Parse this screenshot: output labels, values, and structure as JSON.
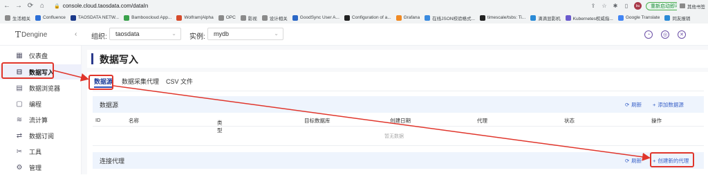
{
  "browser": {
    "url": "console.cloud.taosdata.com/dataIn",
    "relaunch_label": "重新启动即可更新",
    "profile_initial": "bu",
    "bookmarks": [
      {
        "label": "生活相关",
        "color": "#8a8a8a"
      },
      {
        "label": "Confluence",
        "color": "#2c6fd6"
      },
      {
        "label": "TAOSDATA NETW...",
        "color": "#1b3a8a"
      },
      {
        "label": "Bamboocloud App...",
        "color": "#3aa14b"
      },
      {
        "label": "Wolfram|Alpha",
        "color": "#d64b2c"
      },
      {
        "label": "OPC",
        "color": "#8a8a8a"
      },
      {
        "label": "影视",
        "color": "#8a8a8a"
      },
      {
        "label": "设计相关",
        "color": "#8a8a8a"
      },
      {
        "label": "GoodSync User A...",
        "color": "#2b67c6"
      },
      {
        "label": "Configuration of a...",
        "color": "#222222"
      },
      {
        "label": "Grafana",
        "color": "#f08a24"
      },
      {
        "label": "在线JSON校验格式...",
        "color": "#3a8adf"
      },
      {
        "label": "timescale/tsbs: Ti...",
        "color": "#222222"
      },
      {
        "label": "滴滴显影机",
        "color": "#2a8ad6"
      },
      {
        "label": "Kubernetes权威指...",
        "color": "#6a5acd"
      },
      {
        "label": "Google Translate",
        "color": "#4285f4"
      },
      {
        "label": "同友报销",
        "color": "#2a8ad6"
      }
    ],
    "other_bookmarks": "其他书签"
  },
  "header": {
    "logo_text": "Dengine",
    "logo_mark": "T",
    "org_label": "组织:",
    "org_value": "taosdata",
    "instance_label": "实例:",
    "instance_value": "mydb"
  },
  "sidebar": {
    "items": [
      {
        "label": "仪表盘",
        "icon": "dashboard-icon"
      },
      {
        "label": "数据写入",
        "icon": "data-in-icon",
        "active": true
      },
      {
        "label": "数据浏览器",
        "icon": "explorer-icon"
      },
      {
        "label": "编程",
        "icon": "code-icon"
      },
      {
        "label": "流计算",
        "icon": "stream-icon"
      },
      {
        "label": "数据订阅",
        "icon": "subscribe-icon"
      },
      {
        "label": "工具",
        "icon": "tools-icon"
      },
      {
        "label": "管理",
        "icon": "admin-icon"
      }
    ]
  },
  "main": {
    "title": "数据写入",
    "tabs": [
      {
        "label": "数据源",
        "active": true
      },
      {
        "label": "数据采集代理"
      },
      {
        "label": "CSV 文件"
      }
    ],
    "datasource": {
      "heading": "数据源",
      "refresh": "刷新",
      "add": "添加数据源",
      "columns": [
        "ID",
        "名称",
        "类型",
        "目标数据库",
        "创建日期",
        "代理",
        "状态",
        "操作"
      ],
      "empty_text": "暂无数据"
    },
    "agent": {
      "heading": "连接代理",
      "refresh": "刷新",
      "create": "创建新的代理"
    }
  },
  "colors": {
    "accent": "#2b4fb5",
    "annotation": "#e0352b",
    "section_bg": "#eef4fd"
  }
}
